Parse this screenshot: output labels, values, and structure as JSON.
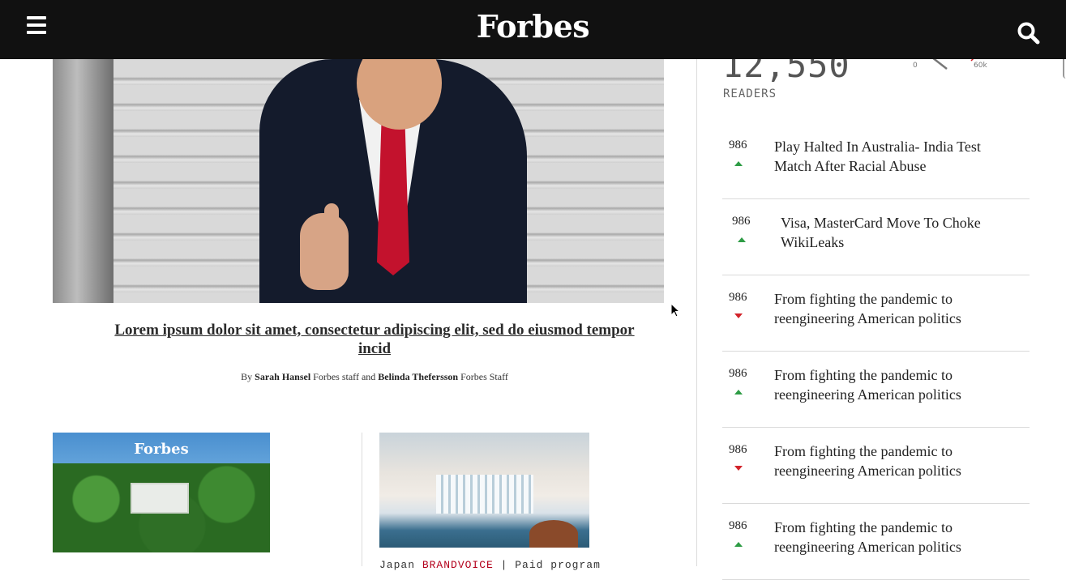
{
  "header": {
    "logo": "Forbes",
    "menu_icon": "hamburger-icon",
    "search_icon": "search-icon"
  },
  "hero": {
    "headline": "Lorem ipsum dolor sit amet, consectetur adipiscing elit, sed do eiusmod tempor incid",
    "byline": {
      "by": "By",
      "author1": "Sarah Hansel",
      "role1": "Forbes staff and",
      "author2": "Belinda Thefersson",
      "role2": "Forbes Staff"
    }
  },
  "cards": {
    "card1_logo": "Forbes",
    "card2_meta_prefix": "Japan",
    "card2_meta_brand": "BRANDVOICE",
    "card2_meta_suffix": "| Paid program"
  },
  "readers": {
    "count": "12,550",
    "label": "READERS",
    "gauge_min": "0",
    "gauge_max": "60k"
  },
  "trending": [
    {
      "count": "986",
      "direction": "up",
      "title": "Play Halted In Australia- India Test Match After Racial Abuse"
    },
    {
      "count": "986",
      "direction": "up",
      "title": "Visa, MasterCard Move To Choke WikiLeaks"
    },
    {
      "count": "986",
      "direction": "down",
      "title": "From fighting the pandemic to reengineering American politics"
    },
    {
      "count": "986",
      "direction": "up",
      "title": "From fighting the pandemic to reengineering American politics"
    },
    {
      "count": "986",
      "direction": "down",
      "title": "From fighting the pandemic to reengineering American politics"
    },
    {
      "count": "986",
      "direction": "up",
      "title": "From fighting the pandemic to reengineering American politics"
    }
  ],
  "colors": {
    "header_bg": "#111111",
    "trend_up": "#2e9c45",
    "trend_down": "#d2232a",
    "brandvoice": "#b3001b"
  }
}
